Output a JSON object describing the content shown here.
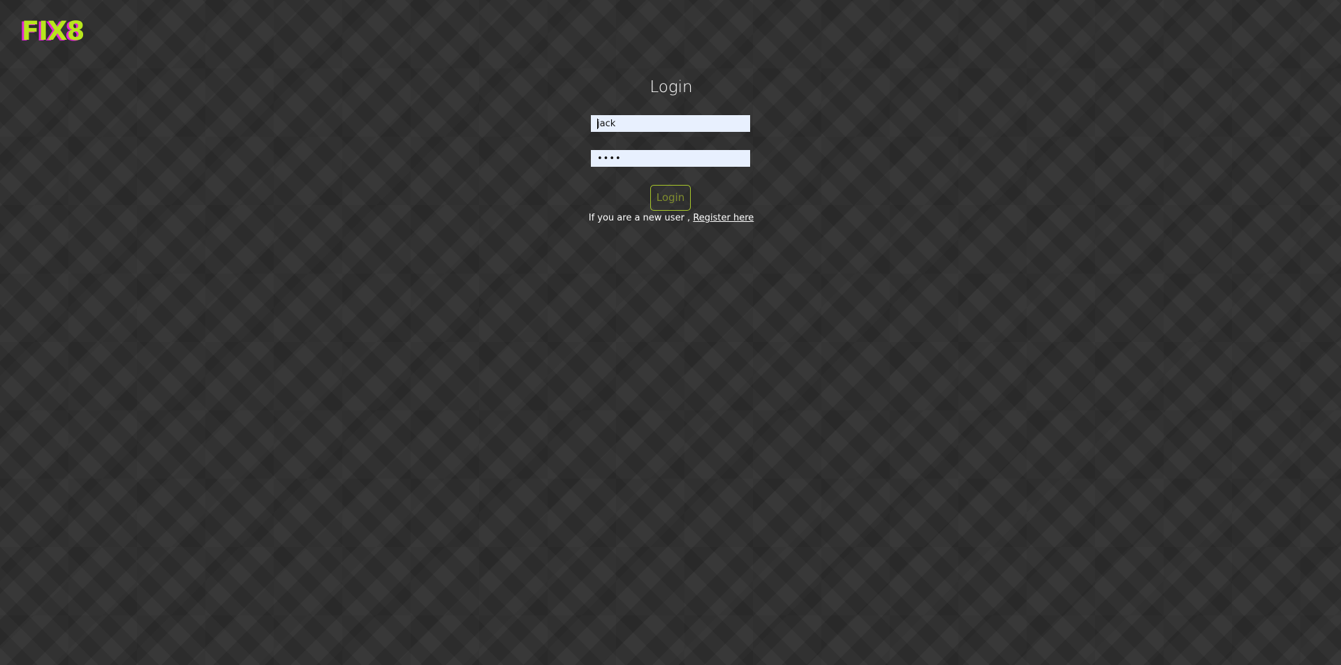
{
  "brand": {
    "logo_text": "FIX8",
    "primary_color": "#b7e61d",
    "accent_color": "#e523d8"
  },
  "login": {
    "title": "Login",
    "username_value": "jack",
    "password_value": "jack",
    "submit_label": "Login",
    "register_prompt": "If you are a new user ,",
    "register_link_label": "Register here"
  },
  "colors": {
    "background": "#313131",
    "input_background": "#e8f0fe",
    "button_border": "#a9c82b",
    "button_text": "#7e8b2d"
  }
}
